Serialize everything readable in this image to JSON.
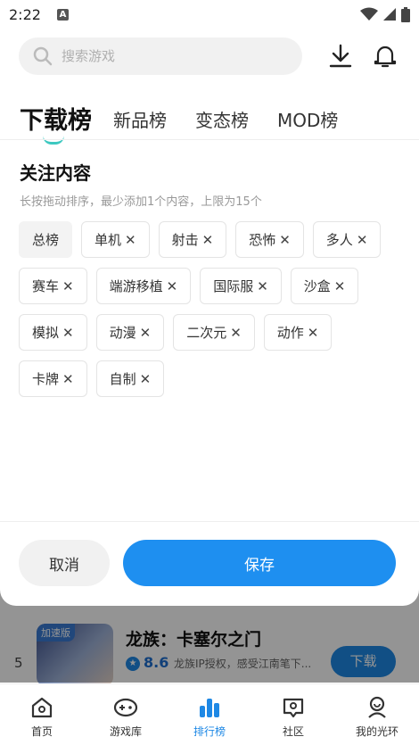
{
  "status_bar": {
    "time": "2:22",
    "notification_icon": "A"
  },
  "search": {
    "placeholder": "搜索游戏"
  },
  "tabs": [
    {
      "label": "下载榜",
      "active": true
    },
    {
      "label": "新品榜"
    },
    {
      "label": "变态榜"
    },
    {
      "label": "MOD榜"
    }
  ],
  "section": {
    "title": "关注内容",
    "hint": "长按拖动排序，最少添加1个内容，上限为15个"
  },
  "tags": [
    {
      "label": "总榜",
      "removable": false
    },
    {
      "label": "单机",
      "removable": true
    },
    {
      "label": "射击",
      "removable": true
    },
    {
      "label": "恐怖",
      "removable": true
    },
    {
      "label": "多人",
      "removable": true
    },
    {
      "label": "赛车",
      "removable": true
    },
    {
      "label": "端游移植",
      "removable": true
    },
    {
      "label": "国际服",
      "removable": true
    },
    {
      "label": "沙盒",
      "removable": true
    },
    {
      "label": "模拟",
      "removable": true
    },
    {
      "label": "动漫",
      "removable": true
    },
    {
      "label": "二次元",
      "removable": true
    },
    {
      "label": "动作",
      "removable": true
    },
    {
      "label": "卡牌",
      "removable": true
    },
    {
      "label": "自制",
      "removable": true
    }
  ],
  "remove_glyph": "✕",
  "actions": {
    "cancel": "取消",
    "save": "保存"
  },
  "background_item": {
    "rank": "5",
    "badge": "加速版",
    "title": "龙族：卡塞尔之门",
    "score": "8.6",
    "description": "龙族IP授权，感受江南笔下...",
    "button": "下载"
  },
  "bottom_nav": [
    {
      "label": "首页",
      "icon": "home-icon"
    },
    {
      "label": "游戏库",
      "icon": "gamepad-icon"
    },
    {
      "label": "排行榜",
      "icon": "ranking-icon",
      "active": true
    },
    {
      "label": "社区",
      "icon": "community-icon"
    },
    {
      "label": "我的光环",
      "icon": "profile-icon"
    }
  ],
  "colors": {
    "accent": "#1e8ff0",
    "tab_indicator": "#3cc8c0"
  }
}
